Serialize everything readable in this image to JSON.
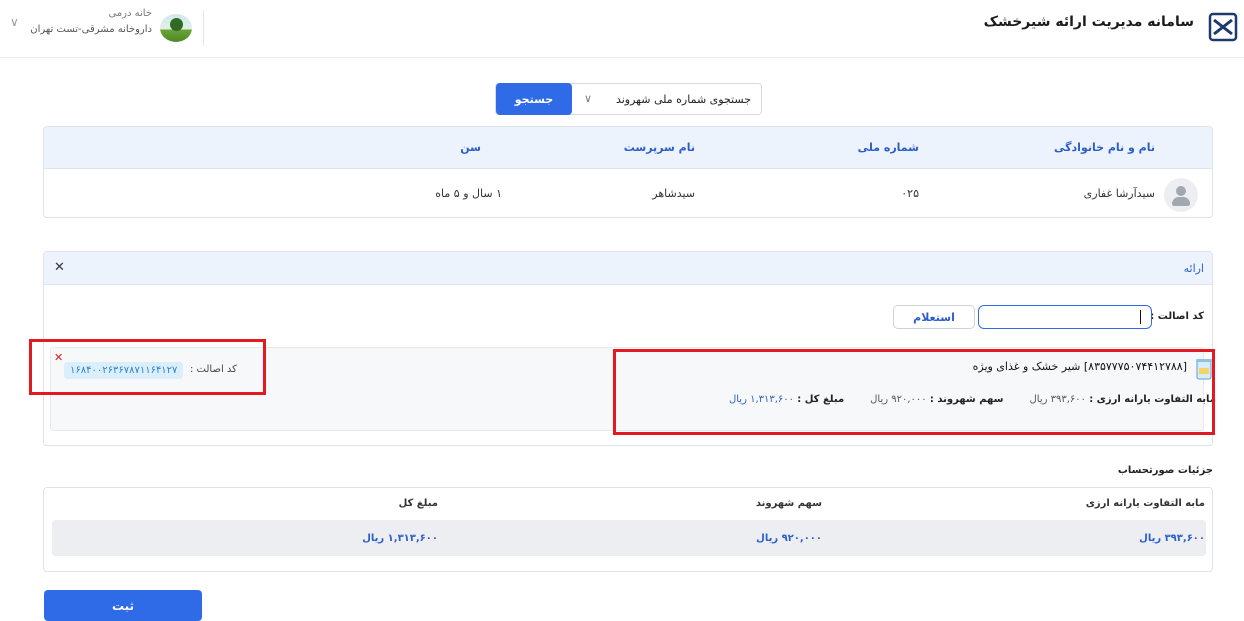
{
  "header": {
    "app_title": "سامانه مدیریت ارائه شیرخشک",
    "user_name": "خانه درمی",
    "pharmacy_name": "داروخانه مشرقی-تست تهران"
  },
  "search": {
    "select_label": "جستجوی شماره ملی شهروند",
    "button_label": "جستجو"
  },
  "citizen_table": {
    "headers": {
      "name": "نام و نام خانوادگی",
      "national_id": "شماره ملی",
      "guardian": "نام سرپرست",
      "age": "سن"
    },
    "row": {
      "name": "سیدآرشا غفاری",
      "national_id": "۰۲۵",
      "guardian": "سیدشاهر",
      "age": "۱ سال و ۵ ماه"
    }
  },
  "delivery_panel": {
    "title": "ارائه",
    "code_label": "کد اصالت :",
    "code_value": "",
    "inquiry_label": "استعلام",
    "item": {
      "tag_label": "کد اصالت :",
      "tag_code": "۱۶۸۴۰۰۲۶۳۶۷۸۷۱۱۶۴۱۲۷",
      "product_title": "[۸۳۵۷۷۷۵۰۷۴۴۱۲۷۸۸] شیر خشک و غذای ویژه",
      "subsidy_label": "مابه التفاوت یارانه ارزی :",
      "subsidy_value": "۳۹۳,۶۰۰ ریال",
      "share_label": "سهم شهروند :",
      "share_value": "۹۲۰,۰۰۰ ریال",
      "total_label": "مبلغ کل :",
      "total_value": "۱,۳۱۳,۶۰۰ ریال"
    }
  },
  "invoice": {
    "title": "جزئیات صورتحساب",
    "headers": {
      "subsidy": "مابه التفاوت یارانه ارزی",
      "share": "سهم شهروند",
      "total": "مبلغ کل"
    },
    "row": {
      "subsidy": "۳۹۳,۶۰۰ ریال",
      "share": "۹۲۰,۰۰۰ ریال",
      "total": "۱,۳۱۳,۶۰۰ ریال"
    }
  },
  "submit_label": "ثبت",
  "colors": {
    "primary": "#2f6be6",
    "header_blue": "#2d5ec7",
    "highlight_red": "#e21b22",
    "tag_bg": "#dbeefc"
  }
}
